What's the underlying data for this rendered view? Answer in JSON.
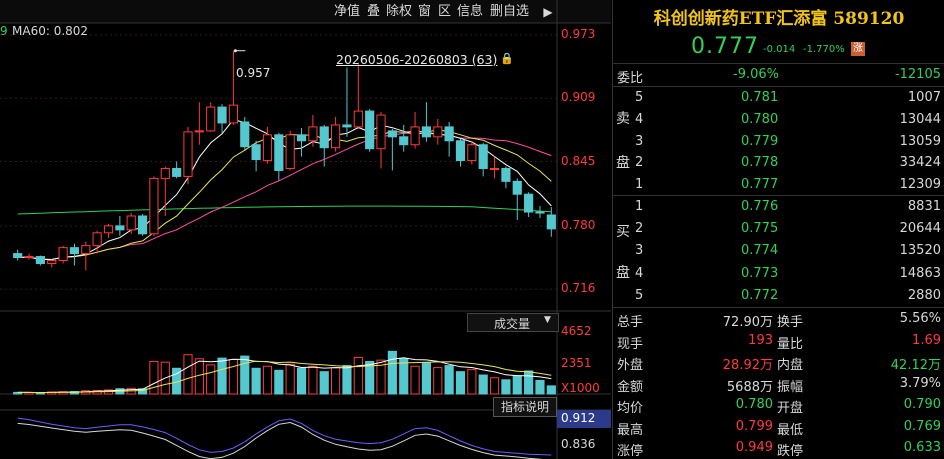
{
  "toolbar": {
    "net_value": "净值",
    "overlay": "叠",
    "ex_right": "除权",
    "window": "窗",
    "interval": "区",
    "info": "信息",
    "remove_watch": "删自选",
    "expand_icon": "expand-right-icon"
  },
  "indicator": {
    "ma_prefix": "9",
    "ma60": "MA60: 0.802"
  },
  "range": {
    "text": "20260506-20260803 (63)",
    "lock_icon": "lock-icon"
  },
  "annotation": {
    "high_label": "0.957"
  },
  "price_axis": [
    "0.973",
    "0.909",
    "0.845",
    "0.780",
    "0.716"
  ],
  "volume": {
    "dropdown_label": "成交量",
    "axis_top": "4652",
    "axis_mid": "2351",
    "unit": "X1000",
    "help_button": "指标说明"
  },
  "lower_axis": {
    "top": "0.912",
    "mid": "0.836"
  },
  "colors": {
    "up": "#ff3a3a",
    "down": "#54c7cf",
    "gold": "#f0c419",
    "green": "#33d058",
    "ma5": "#ffffff",
    "ma10": "#e5e55a",
    "ma20": "#ff4fa0",
    "ma60": "#2fd05a"
  },
  "quote": {
    "title": "科创创新药ETF汇添富 589120",
    "price": "0.777",
    "change": "-0.014",
    "change_pct": "-1.770%",
    "limit_badge": "涨",
    "weibi_label": "委比",
    "weibi_pct": "-9.06%",
    "weibi_diff": "-12105",
    "sell_label": [
      "卖",
      "盘"
    ],
    "buy_label": [
      "买",
      "盘"
    ],
    "asks": [
      {
        "level": "5",
        "price": "0.781",
        "vol": "1007"
      },
      {
        "level": "4",
        "price": "0.780",
        "vol": "13044"
      },
      {
        "level": "3",
        "price": "0.779",
        "vol": "13059"
      },
      {
        "level": "2",
        "price": "0.778",
        "vol": "33424"
      },
      {
        "level": "1",
        "price": "0.777",
        "vol": "12309"
      }
    ],
    "bids": [
      {
        "level": "1",
        "price": "0.776",
        "vol": "8831"
      },
      {
        "level": "2",
        "price": "0.775",
        "vol": "20644"
      },
      {
        "level": "3",
        "price": "0.774",
        "vol": "13520"
      },
      {
        "level": "4",
        "price": "0.773",
        "vol": "14863"
      },
      {
        "level": "5",
        "price": "0.772",
        "vol": "2880"
      }
    ],
    "stats": [
      {
        "l1": "总手",
        "v1": "72.90万",
        "l2": "换手",
        "v2": "5.56%"
      },
      {
        "l1": "现手",
        "v1": "193",
        "l2": "量比",
        "v2": "1.69"
      },
      {
        "l1": "外盘",
        "v1": "28.92万",
        "l2": "内盘",
        "v2": "42.12万"
      },
      {
        "l1": "金额",
        "v1": "5688万",
        "l2": "振幅",
        "v2": "3.79%"
      },
      {
        "l1": "均价",
        "v1": "0.780",
        "l2": "开盘",
        "v2": "0.790"
      },
      {
        "l1": "最高",
        "v1": "0.799",
        "l2": "最低",
        "v2": "0.769"
      },
      {
        "l1": "涨停",
        "v1": "0.949",
        "l2": "跌停",
        "v2": "0.633"
      }
    ]
  },
  "chart_data": {
    "type": "candlestick",
    "candles": [
      {
        "o": 0.752,
        "c": 0.748,
        "h": 0.756,
        "l": 0.745
      },
      {
        "o": 0.748,
        "c": 0.749,
        "h": 0.752,
        "l": 0.746
      },
      {
        "o": 0.749,
        "c": 0.742,
        "h": 0.75,
        "l": 0.74
      },
      {
        "o": 0.742,
        "c": 0.745,
        "h": 0.746,
        "l": 0.738
      },
      {
        "o": 0.745,
        "c": 0.758,
        "h": 0.76,
        "l": 0.742
      },
      {
        "o": 0.758,
        "c": 0.752,
        "h": 0.762,
        "l": 0.74
      },
      {
        "o": 0.752,
        "c": 0.76,
        "h": 0.764,
        "l": 0.735
      },
      {
        "o": 0.76,
        "c": 0.773,
        "h": 0.775,
        "l": 0.752
      },
      {
        "o": 0.773,
        "c": 0.78,
        "h": 0.782,
        "l": 0.768
      },
      {
        "o": 0.78,
        "c": 0.776,
        "h": 0.79,
        "l": 0.77
      },
      {
        "o": 0.776,
        "c": 0.79,
        "h": 0.793,
        "l": 0.772
      },
      {
        "o": 0.79,
        "c": 0.772,
        "h": 0.792,
        "l": 0.77
      },
      {
        "o": 0.772,
        "c": 0.828,
        "h": 0.83,
        "l": 0.77
      },
      {
        "o": 0.828,
        "c": 0.838,
        "h": 0.84,
        "l": 0.79
      },
      {
        "o": 0.838,
        "c": 0.83,
        "h": 0.845,
        "l": 0.828
      },
      {
        "o": 0.83,
        "c": 0.875,
        "h": 0.88,
        "l": 0.822
      },
      {
        "o": 0.875,
        "c": 0.876,
        "h": 0.905,
        "l": 0.862
      },
      {
        "o": 0.876,
        "c": 0.9,
        "h": 0.905,
        "l": 0.875
      },
      {
        "o": 0.9,
        "c": 0.884,
        "h": 0.903,
        "l": 0.874
      },
      {
        "o": 0.884,
        "c": 0.902,
        "h": 0.957,
        "l": 0.882
      },
      {
        "o": 0.885,
        "c": 0.86,
        "h": 0.89,
        "l": 0.857
      },
      {
        "o": 0.862,
        "c": 0.847,
        "h": 0.866,
        "l": 0.835
      },
      {
        "o": 0.846,
        "c": 0.872,
        "h": 0.88,
        "l": 0.843
      },
      {
        "o": 0.872,
        "c": 0.836,
        "h": 0.874,
        "l": 0.826
      },
      {
        "o": 0.838,
        "c": 0.872,
        "h": 0.876,
        "l": 0.836
      },
      {
        "o": 0.872,
        "c": 0.866,
        "h": 0.879,
        "l": 0.85
      },
      {
        "o": 0.866,
        "c": 0.88,
        "h": 0.892,
        "l": 0.86
      },
      {
        "o": 0.88,
        "c": 0.859,
        "h": 0.882,
        "l": 0.84
      },
      {
        "o": 0.859,
        "c": 0.882,
        "h": 0.89,
        "l": 0.855
      },
      {
        "o": 0.882,
        "c": 0.88,
        "h": 0.94,
        "l": 0.87
      },
      {
        "o": 0.88,
        "c": 0.896,
        "h": 0.945,
        "l": 0.878
      },
      {
        "o": 0.896,
        "c": 0.858,
        "h": 0.898,
        "l": 0.855
      },
      {
        "o": 0.858,
        "c": 0.892,
        "h": 0.895,
        "l": 0.838
      },
      {
        "o": 0.876,
        "c": 0.87,
        "h": 0.878,
        "l": 0.836
      },
      {
        "o": 0.87,
        "c": 0.862,
        "h": 0.882,
        "l": 0.855
      },
      {
        "o": 0.862,
        "c": 0.88,
        "h": 0.895,
        "l": 0.858
      },
      {
        "o": 0.88,
        "c": 0.87,
        "h": 0.905,
        "l": 0.865
      },
      {
        "o": 0.87,
        "c": 0.88,
        "h": 0.888,
        "l": 0.862
      },
      {
        "o": 0.88,
        "c": 0.866,
        "h": 0.885,
        "l": 0.85
      },
      {
        "o": 0.866,
        "c": 0.846,
        "h": 0.868,
        "l": 0.84
      },
      {
        "o": 0.846,
        "c": 0.862,
        "h": 0.866,
        "l": 0.842
      },
      {
        "o": 0.862,
        "c": 0.838,
        "h": 0.864,
        "l": 0.83
      },
      {
        "o": 0.838,
        "c": 0.838,
        "h": 0.85,
        "l": 0.828
      },
      {
        "o": 0.838,
        "c": 0.825,
        "h": 0.84,
        "l": 0.818
      },
      {
        "o": 0.825,
        "c": 0.812,
        "h": 0.828,
        "l": 0.786
      },
      {
        "o": 0.812,
        "c": 0.794,
        "h": 0.814,
        "l": 0.789
      },
      {
        "o": 0.794,
        "c": 0.793,
        "h": 0.8,
        "l": 0.788
      },
      {
        "o": 0.791,
        "c": 0.777,
        "h": 0.799,
        "l": 0.769
      }
    ],
    "price_range": [
      0.695,
      0.985
    ],
    "price_ticks": [
      0.973,
      0.909,
      0.845,
      0.78,
      0.716
    ],
    "volume_series": [
      120,
      110,
      90,
      140,
      170,
      180,
      240,
      260,
      300,
      390,
      420,
      380,
      2400,
      2350,
      1900,
      2900,
      2600,
      2150,
      2650,
      2550,
      2800,
      1900,
      2050,
      1750,
      2200,
      1900,
      2050,
      1650,
      1950,
      2100,
      2700,
      2400,
      2500,
      3150,
      2600,
      2050,
      2300,
      1950,
      2100,
      1650,
      1800,
      1400,
      1200,
      1050,
      1350,
      1700,
      1000,
      600
    ],
    "volume_range": [
      0,
      4652
    ],
    "volume_ticks": [
      4652,
      2351
    ],
    "lower_indicator": [
      0.918,
      0.914,
      0.909,
      0.904,
      0.9,
      0.896,
      0.894,
      0.897,
      0.9,
      0.903,
      0.903,
      0.898,
      0.892,
      0.885,
      0.872,
      0.858,
      0.846,
      0.84,
      0.842,
      0.85,
      0.864,
      0.882,
      0.898,
      0.912,
      0.916,
      0.906,
      0.89,
      0.878,
      0.87,
      0.866,
      0.862,
      0.86,
      0.862,
      0.87,
      0.882,
      0.894,
      0.896,
      0.89,
      0.878,
      0.866,
      0.856,
      0.848,
      0.842,
      0.84,
      0.838,
      0.836,
      0.835,
      0.834
    ],
    "lower_range": [
      0.825,
      0.925
    ],
    "lower_ticks": [
      0.912,
      0.836
    ]
  }
}
